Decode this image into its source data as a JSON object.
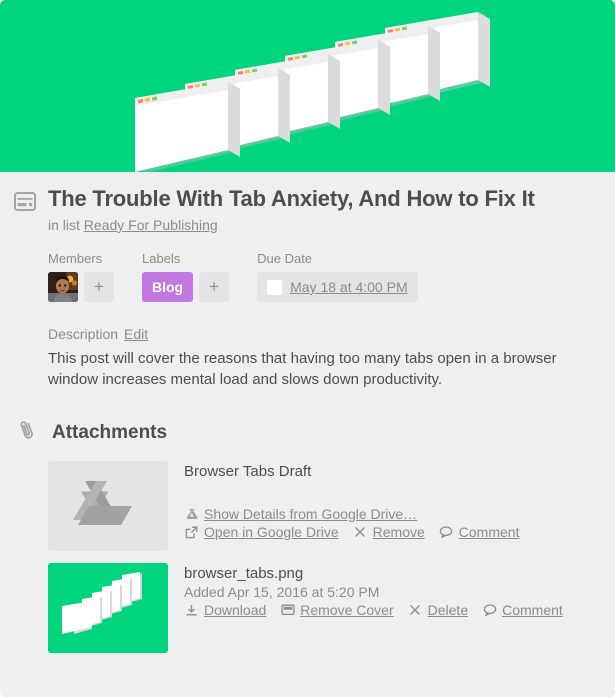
{
  "cover": {
    "background_color": "#00d47f",
    "art": "stacked-browser-windows"
  },
  "card": {
    "icon": "card-window-icon",
    "title": "The Trouble With Tab Anxiety, And How to Fix It",
    "in_list_prefix": "in list",
    "list_name": "Ready For Publishing"
  },
  "badges": {
    "members": {
      "label": "Members",
      "add_label": "+",
      "avatar_name": "member-avatar"
    },
    "labels": {
      "label": "Labels",
      "chips": [
        {
          "text": "Blog",
          "color": "#c377e0"
        }
      ],
      "add_label": "+"
    },
    "due_date": {
      "label": "Due Date",
      "value": "May 18 at 4:00 PM",
      "checked": false
    }
  },
  "description": {
    "heading": "Description",
    "edit_label": "Edit",
    "text": "This post will cover the reasons that having too many tabs open in a browser window increases mental load and slows down productivity."
  },
  "attachments": {
    "heading": "Attachments",
    "icon": "paperclip-icon",
    "items": [
      {
        "name": "Browser Tabs Draft",
        "subtitle": "",
        "thumb_kind": "google-drive",
        "actions": [
          {
            "icon": "google-drive-icon",
            "label": "Show Details from Google Drive…"
          },
          {
            "icon": "external-link-icon",
            "label": "Open in Google Drive"
          },
          {
            "icon": "close-x-icon",
            "label": "Remove"
          },
          {
            "icon": "comment-icon",
            "label": "Comment"
          }
        ]
      },
      {
        "name": "browser_tabs.png",
        "subtitle": "Added Apr 15, 2016 at 5:20 PM",
        "thumb_kind": "browser-tabs-cover",
        "actions": [
          {
            "icon": "download-icon",
            "label": "Download"
          },
          {
            "icon": "cover-window-icon",
            "label": "Remove Cover"
          },
          {
            "icon": "close-x-icon",
            "label": "Delete"
          },
          {
            "icon": "comment-icon",
            "label": "Comment"
          }
        ]
      }
    ]
  }
}
